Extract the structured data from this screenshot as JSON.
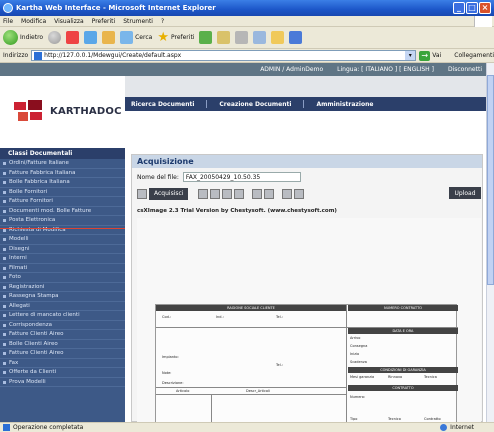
{
  "window": {
    "title": "Kartha Web Interface - Microsoft Internet Explorer"
  },
  "menu": [
    "File",
    "Modifica",
    "Visualizza",
    "Preferiti",
    "Strumenti",
    "?"
  ],
  "toolbar": {
    "back_label": "Indietro",
    "search_label": "Cerca",
    "favorites_label": "Preferiti"
  },
  "address": {
    "label": "Indirizzo",
    "url": "http://127.0.0.1/Mdewgui/Create/default.aspx",
    "go_label": "Vai",
    "links_label": "Collegamenti"
  },
  "app": {
    "user": "ADMIN / AdminDemo",
    "language": "Lingua: [ ITALIANO ] [ ENGLISH ]",
    "logout": "Disconnetti",
    "logo_text": "KARTHADOC",
    "nav": [
      "Ricerca Documenti",
      "Creazione Documenti",
      "Amministrazione"
    ]
  },
  "sidebar": {
    "title": "Classi Documentali",
    "items": [
      "Ordini/Fatture Italiane",
      "Fatture Fabbrica Italiana",
      "Bolle Fabbrica Italiana",
      "Bolle Fornitori",
      "Fatture Fornitori",
      "Documenti mod. Bolle Fatture",
      "Posta Elettronica",
      "Richiesta di Modifica",
      "Modelli",
      "Disegni",
      "Interni",
      "Filmati",
      "Foto",
      "Registrazioni",
      "Rassegna Stampa",
      "Allegati",
      "Lettere di mancato clienti",
      "Corrispondenza",
      "Fatture Clienti Aireo",
      "Bolle Clienti Aireo",
      "Fatture Clienti Aireo",
      "Fax",
      "Offerte da Clienti",
      "Prova Modelli"
    ]
  },
  "acquisition": {
    "title": "Acquisizione",
    "file_label": "Nome del file:",
    "file_value": "FAX_20050429_10.50.35",
    "acquire_button": "Acquisisci",
    "upload_button": "Upload",
    "trial_text": "csXImage 2.3 Trial Version by Chestysoft. (www.chestysoft.com)"
  },
  "document": {
    "header_left": "RAGIONE SOCIALE CLIENTE",
    "header_right": "NUMERO CONTRATTO",
    "cod_label": "Cod.:",
    "ind_label": "Ind.:",
    "tel_label": "Tel.:",
    "date_band": "DATA E ORA",
    "row_labels": [
      "Arrivo",
      "Consegna",
      "Inizio",
      "Scadenza"
    ],
    "cond_band": "CONDIZIONI DI GARANZIA",
    "cond_cols": [
      "Mesi garanzia",
      "Rinnovo",
      "Tecnica"
    ],
    "contract_band": "CONTRATTO",
    "number_label": "Numero:",
    "bottom_labels": [
      "Tipo",
      "Tecnico",
      "Contratto"
    ],
    "left_labels": [
      "Impianto:",
      "Note:",
      "Descrizione:"
    ],
    "left_right_label": "Tel.:",
    "table_headers": [
      "Articolo",
      "Descr_Articoli"
    ]
  },
  "status": {
    "text": "Operazione completata",
    "zone": "Internet"
  }
}
